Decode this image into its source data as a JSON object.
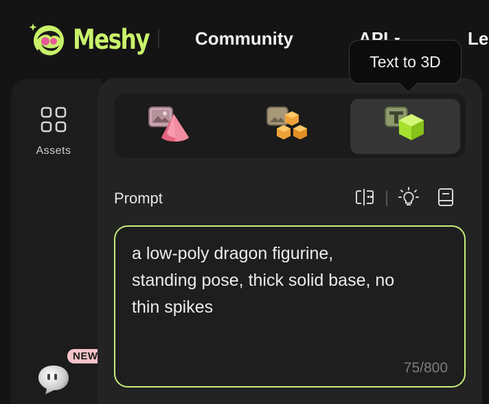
{
  "brand": {
    "name": "Meshy",
    "accent": "#c9f26a"
  },
  "nav": {
    "community": "Community",
    "api": "API",
    "learn": "Le"
  },
  "tooltip": {
    "text": "Text to 3D"
  },
  "sidebar": {
    "assets_label": "Assets",
    "assets_icon": "grid-icon",
    "chat_badge": "NEW"
  },
  "modes": [
    {
      "name": "image-to-3d",
      "icon": "image-cone-icon",
      "selected": false
    },
    {
      "name": "multi-image-to-3d",
      "icon": "image-cubes-icon",
      "selected": false
    },
    {
      "name": "text-to-3d",
      "icon": "text-cube-icon",
      "selected": true
    }
  ],
  "prompt": {
    "label": "Prompt",
    "value": "a low-poly dragon figurine, standing pose, thick solid base, no thin spikes",
    "line1": "a low-poly dragon figurine,",
    "line2": "standing pose, thick solid base, no",
    "line3": "thin spikes",
    "counter": "75/800",
    "tools": [
      "ai-split-icon",
      "lightbulb-icon",
      "book-icon"
    ],
    "border_color": "#c7ee7a"
  }
}
